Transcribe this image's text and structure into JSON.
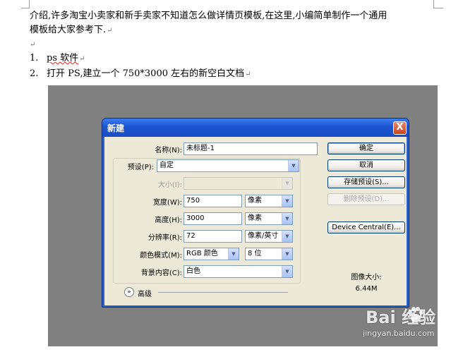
{
  "document": {
    "intro_line1": "介绍,许多淘宝小卖家和新手卖家不知道怎么做详情页模板,在这里,小编简单制作一个通用",
    "intro_line2": "模板给大家参考下.",
    "para_mark": "↵",
    "steps": [
      {
        "num": "1.",
        "text": "ps 软件"
      },
      {
        "num": "2.",
        "text": "打开 PS,建立一个 750*3000 左右的新空白文档"
      }
    ]
  },
  "dialog": {
    "title": "新建",
    "close_label": "X",
    "name_label": "名称(N):",
    "name_value": "未标题-1",
    "preset_label": "预设(P):",
    "preset_value": "自定",
    "size_label": "大小(I):",
    "size_value": "",
    "width_label": "宽度(W):",
    "width_value": "750",
    "width_unit": "像素",
    "height_label": "高度(H):",
    "height_value": "3000",
    "height_unit": "像素",
    "resolution_label": "分辨率(R):",
    "resolution_value": "72",
    "resolution_unit": "像素/英寸",
    "color_mode_label": "颜色模式(M):",
    "color_mode_value": "RGB 颜色",
    "bit_depth_value": "8 位",
    "background_label": "背景内容(C):",
    "background_value": "白色",
    "advanced_label": "高级",
    "buttons": {
      "ok": "确定",
      "cancel": "取消",
      "save_preset": "存储预设(S)...",
      "delete_preset": "删除预设(D)...",
      "device_central": "Device Central(E)..."
    },
    "image_size_label": "图像大小:",
    "image_size_value": "6.44M"
  },
  "watermark": {
    "logo_text": "Bai 经验",
    "url": "jingyan.baidu.com"
  }
}
